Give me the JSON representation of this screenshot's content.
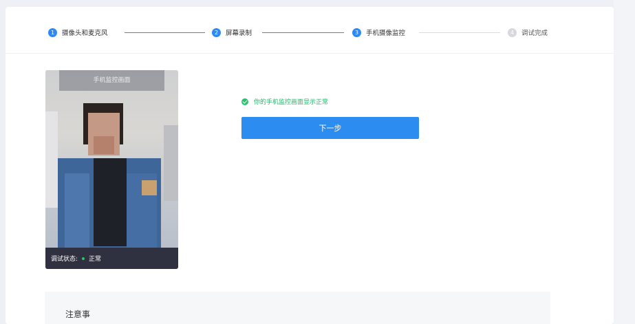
{
  "steps": [
    {
      "number": "1",
      "label": "摄像头和麦克风",
      "state": "done"
    },
    {
      "number": "2",
      "label": "屏幕录制",
      "state": "done"
    },
    {
      "number": "3",
      "label": "手机摄像监控",
      "state": "active"
    },
    {
      "number": "4",
      "label": "调试完成",
      "state": "inactive"
    }
  ],
  "preview": {
    "title": "手机监控画面",
    "status_label": "调试状态:",
    "status_value": "正常",
    "status_color": "#29c46e"
  },
  "message": {
    "text": "你的手机监控画面显示正常",
    "color": "#25b56a"
  },
  "next_button": {
    "label": "下一步"
  },
  "notes": {
    "title": "注意事"
  },
  "colors": {
    "accent": "#2d8cf0",
    "inactive": "#d6d8dd"
  }
}
